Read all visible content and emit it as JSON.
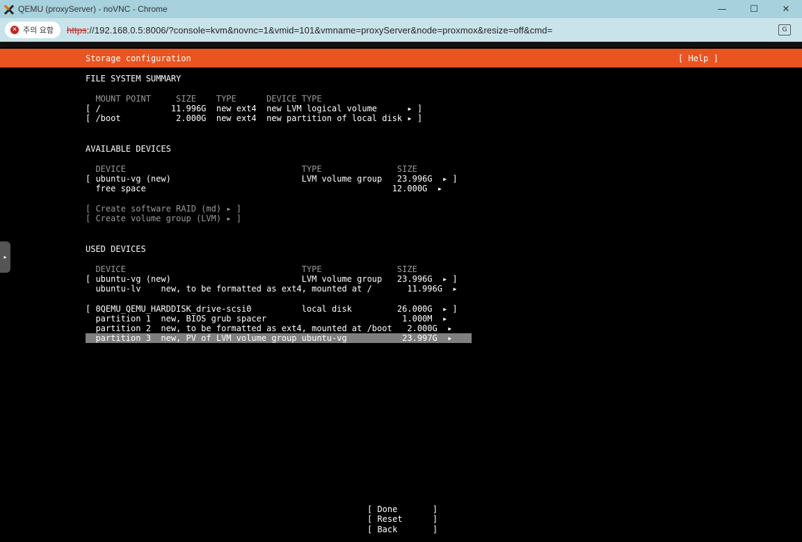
{
  "window": {
    "title": "QEMU (proxyServer) - noVNC - Chrome",
    "minimize_glyph": "—",
    "maximize_glyph": "☐",
    "close_glyph": "✕"
  },
  "addressbar": {
    "security_label": "주의 요함",
    "url_protocol": "https",
    "url_rest": "://192.168.0.5:8006/?console=kvm&novnc=1&vmid=101&vmname=proxyServer&node=proxmox&resize=off&cmd="
  },
  "installer": {
    "header_title": "Storage configuration",
    "help_label": "[ Help ]",
    "fs_summary": {
      "title": "FILE SYSTEM SUMMARY",
      "columns": "  MOUNT POINT     SIZE    TYPE      DEVICE TYPE",
      "rows": [
        "[ /              11.996G  new ext4  new LVM logical volume      ▸ ]",
        "[ /boot           2.000G  new ext4  new partition of local disk ▸ ]"
      ]
    },
    "available": {
      "title": "AVAILABLE DEVICES",
      "columns": "  DEVICE                                   TYPE               SIZE",
      "rows": [
        "[ ubuntu-vg (new)                          LVM volume group   23.996G  ▸ ]",
        "  free space                                                 12.000G  ▸"
      ],
      "actions": [
        "[ Create software RAID (md) ▸ ]",
        "[ Create volume group (LVM) ▸ ]"
      ]
    },
    "used": {
      "title": "USED DEVICES",
      "columns": "  DEVICE                                   TYPE               SIZE",
      "rows": [
        "[ ubuntu-vg (new)                          LVM volume group   23.996G  ▸ ]",
        "  ubuntu-lv    new, to be formatted as ext4, mounted at /       11.996G  ▸",
        "[ 0QEMU_QEMU_HARDDISK_drive-scsi0          local disk         26.000G  ▸ ]",
        "  partition 1  new, BIOS grub spacer                           1.000M  ▸",
        "  partition 2  new, to be formatted as ext4, mounted at /boot   2.000G  ▸",
        "  partition 3  new, PV of LVM volume group ubuntu-vg           23.997G  ▸  "
      ]
    },
    "buttons": {
      "done": "[ Done       ]",
      "reset": "[ Reset      ]",
      "back": "[ Back       ]"
    },
    "side_tab_glyph": "▸"
  }
}
